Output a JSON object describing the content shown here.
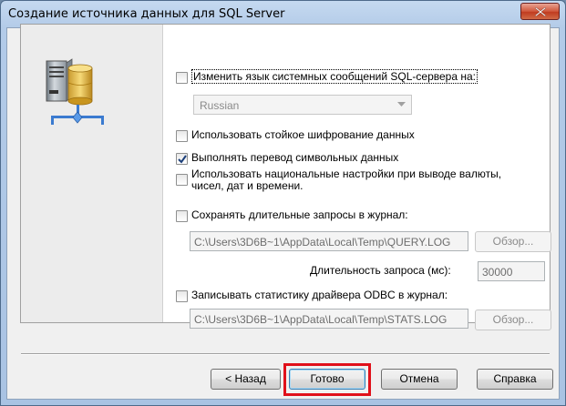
{
  "window": {
    "title": "Создание источника данных для SQL Server",
    "accent_color": "#e0101a"
  },
  "options": {
    "change_language": {
      "label": "Изменить язык системных сообщений SQL-сервера на:",
      "checked": false
    },
    "language_select": {
      "value": "Russian"
    },
    "strong_encryption": {
      "label": "Использовать стойкое шифрование данных",
      "checked": false
    },
    "translate_chars": {
      "label": "Выполнять перевод символьных данных",
      "checked": true
    },
    "regional_settings": {
      "label_line1": "Использовать национальные настройки при выводе валюты,",
      "label_line2": "чисел, дат и времени.",
      "checked": false
    },
    "log_long_queries": {
      "label": "Сохранять длительные запросы в журнал:",
      "checked": false
    },
    "query_log_path": "C:\\Users\\3D6B~1\\AppData\\Local\\Temp\\QUERY.LOG",
    "browse_label": "Обзор...",
    "query_time_label": "Длительность запроса (мс):",
    "query_time_value": "30000",
    "log_stats": {
      "label": "Записывать статистику драйвера ODBC в журнал:",
      "checked": false
    },
    "stats_log_path": "C:\\Users\\3D6B~1\\AppData\\Local\\Temp\\STATS.LOG",
    "browse2_label": "Обзор..."
  },
  "buttons": {
    "back": "< Назад",
    "finish": "Готово",
    "cancel": "Отмена",
    "help": "Справка"
  },
  "icons": {
    "server": "server-network-icon",
    "close": "close-icon",
    "dropdown": "chevron-down-icon",
    "check": "checkmark-icon"
  }
}
